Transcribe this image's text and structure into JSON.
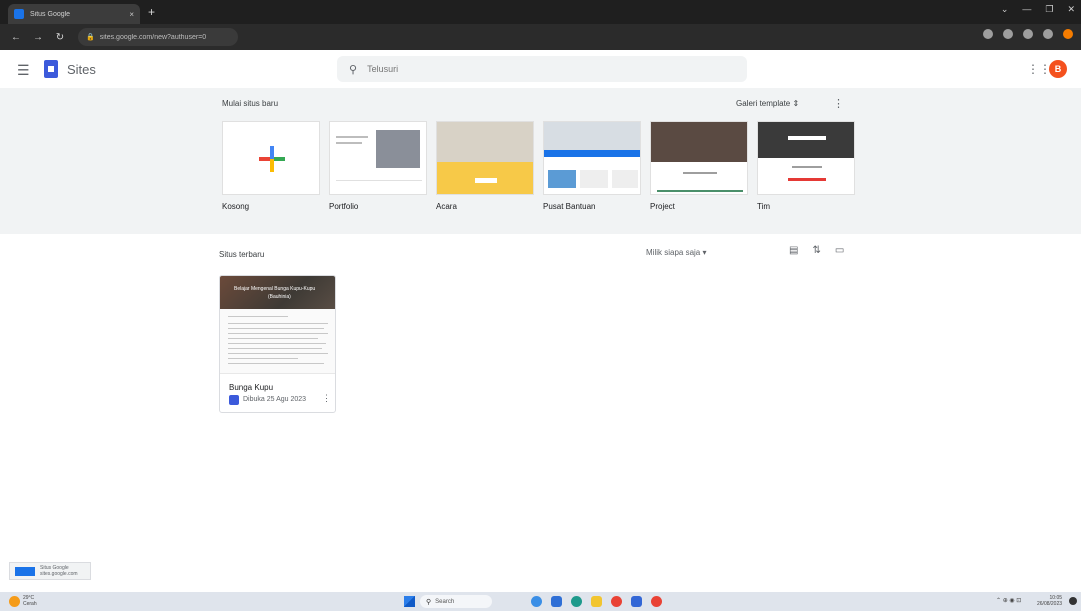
{
  "browser": {
    "tab_title": "Situs Google",
    "tab_close": "×",
    "new_tab": "+",
    "url": "sites.google.com/new?authuser=0",
    "window_controls": [
      "⌄",
      "—",
      "❐",
      "✕"
    ]
  },
  "header": {
    "app_name": "Sites",
    "search_placeholder": "Telusuri",
    "avatar_initial": "B"
  },
  "templates": {
    "heading": "Mulai situs baru",
    "gallery_label": "Galeri template ⇕",
    "items": [
      {
        "label": "Kosong"
      },
      {
        "label": "Portfolio"
      },
      {
        "label": "Acara"
      },
      {
        "label": "Pusat Bantuan"
      },
      {
        "label": "Project"
      },
      {
        "label": "Tim"
      }
    ]
  },
  "recent": {
    "title": "Situs terbaru",
    "owner_filter": "Milik siapa saja ▾",
    "sites": [
      {
        "name": "Bunga Kupu",
        "meta": "Dibuka 25 Agu 2023",
        "thumb_title": "Belajar Mengenal Bunga Kupu-Kupu",
        "thumb_subtitle": "(Bauhinia)"
      }
    ]
  },
  "popup": {
    "line1": "Situs Google",
    "line2": "sites.google.com"
  },
  "taskbar": {
    "weather_temp": "29°C",
    "weather_desc": "Cerah",
    "search_label": "Search",
    "time": "10:05",
    "date": "26/08/2023"
  },
  "colors": {
    "accent": "#1a73e8",
    "avatar": "#f4511e",
    "panel": "#f1f3f4"
  }
}
